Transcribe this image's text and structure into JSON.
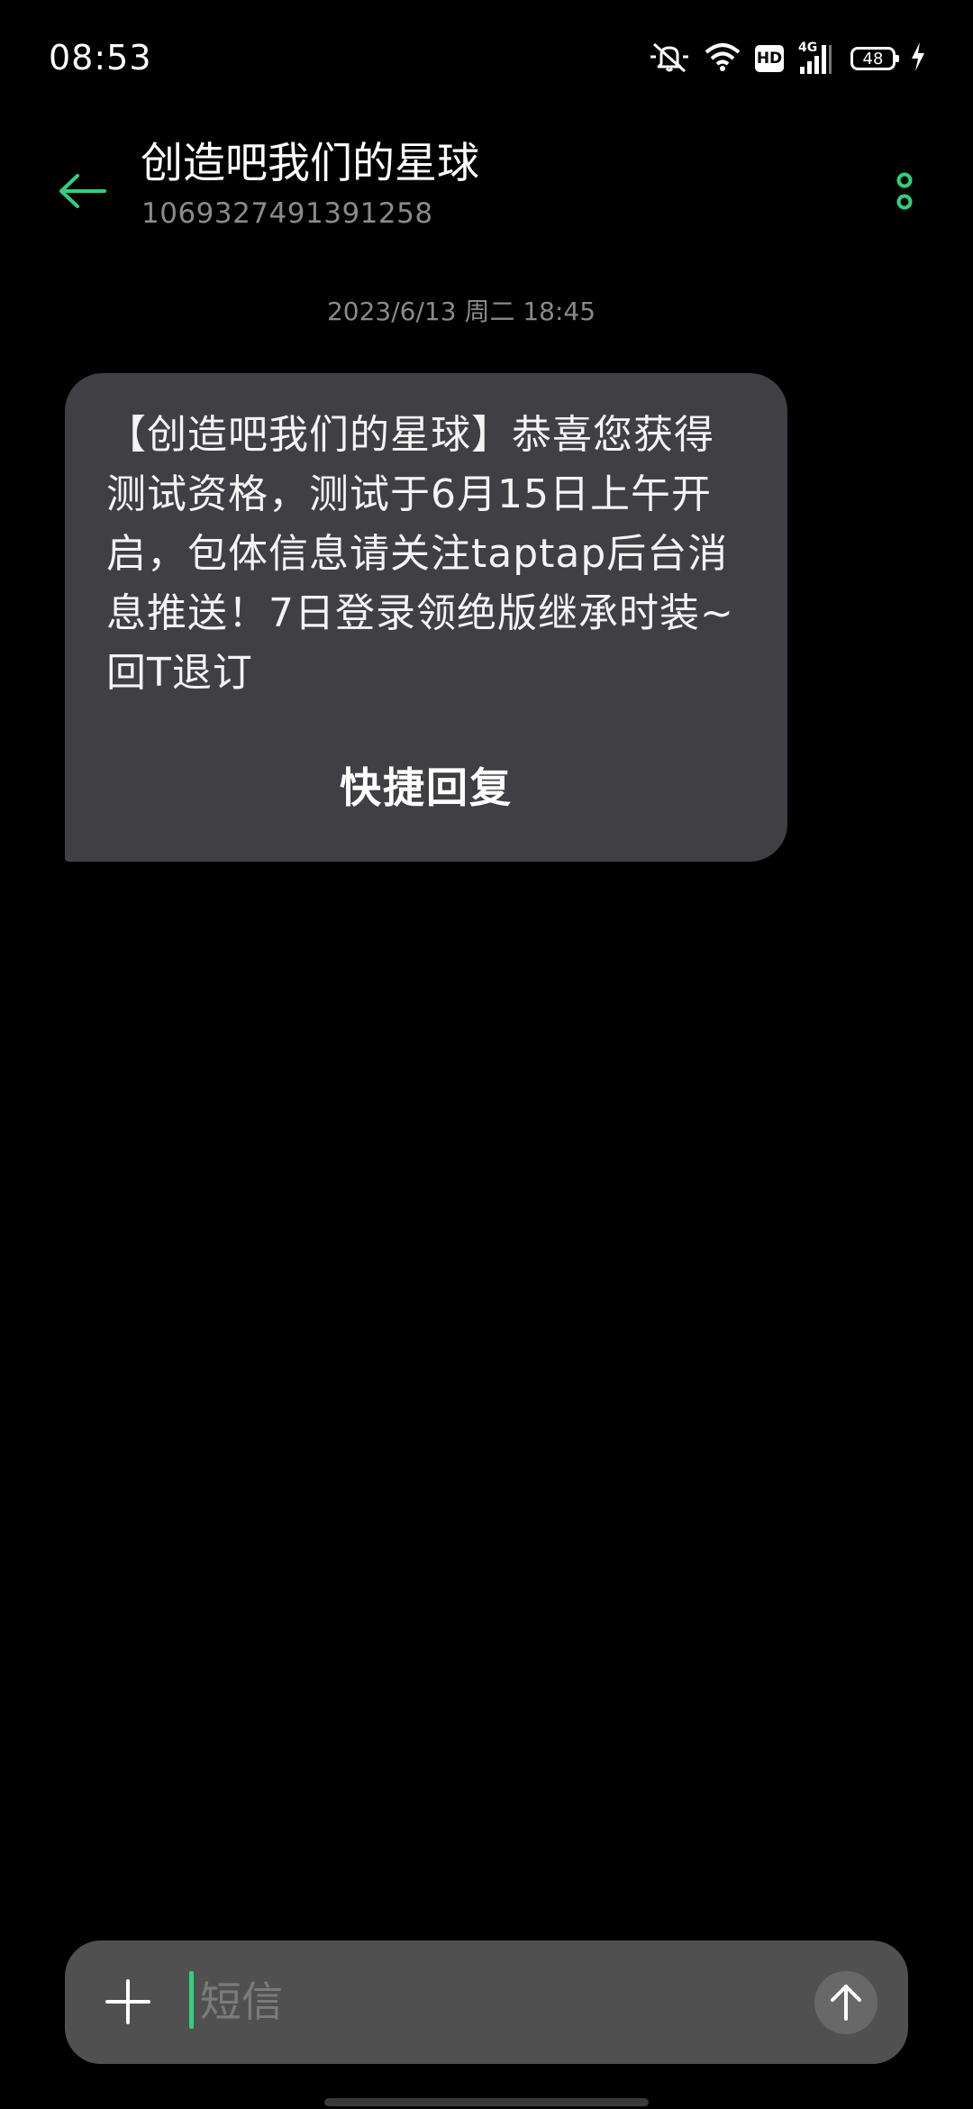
{
  "status_bar": {
    "time": "08:53",
    "icons": [
      "mute-bell-icon",
      "wifi-icon",
      "hd-icon",
      "4g-signal-icon",
      "battery-icon",
      "charging-icon"
    ],
    "hd_label": "HD",
    "network_label": "4G",
    "battery_level": "48"
  },
  "header": {
    "title": "创造吧我们的星球",
    "number": "1069327491391258",
    "accent_color": "#2fd17a"
  },
  "conversation": {
    "timestamp": "2023/6/13 周二 18:45",
    "messages": [
      {
        "text": "【创造吧我们的星球】恭喜您获得测试资格，测试于6月15日上午开启，包体信息请关注taptap后台消息推送！7日登录领绝版继承时装~ 回T退订",
        "quick_reply_label": "快捷回复"
      }
    ]
  },
  "composer": {
    "placeholder": "短信",
    "value": ""
  }
}
